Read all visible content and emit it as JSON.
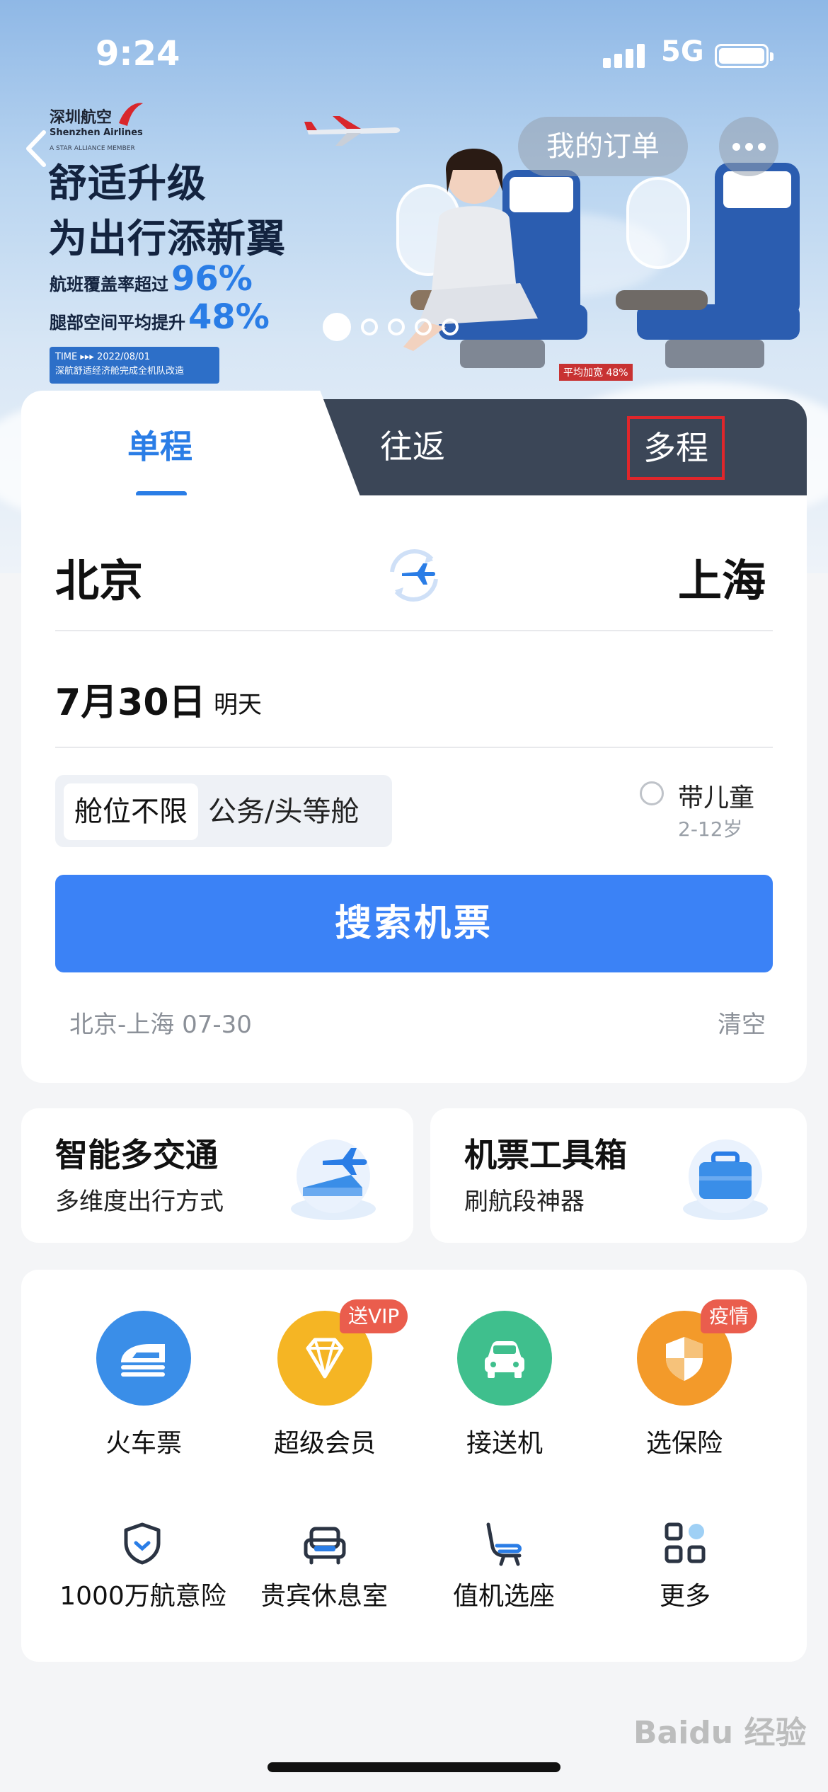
{
  "status_bar": {
    "time": "9:24",
    "network": "5G"
  },
  "header": {
    "orders_label": "我的订单"
  },
  "banner": {
    "airline_cn": "深圳航空",
    "airline_en": "Shenzhen Airlines",
    "alliance": "A STAR ALLIANCE MEMBER",
    "headline_1": "舒适升级",
    "headline_2": "为出行添新翼",
    "stat_1_label": "航班覆盖率超过",
    "stat_1_value": "96%",
    "stat_2_label": "腿部空间平均提升",
    "stat_2_value": "48%",
    "tag_line_1": "TIME ▸▸▸ 2022/08/01",
    "tag_line_2": "深航舒适经济舱完成全机队改造",
    "seat_tag": "平均加宽 48%",
    "page_total": 5,
    "page_current": 1
  },
  "tabs": [
    {
      "label": "单程",
      "active": true
    },
    {
      "label": "往返",
      "active": false
    },
    {
      "label": "多程",
      "active": false,
      "highlighted": true
    }
  ],
  "search": {
    "from_city": "北京",
    "to_city": "上海",
    "date": "7月30日",
    "date_hint": "明天",
    "cabin_options": [
      "舱位不限",
      "公务/头等舱"
    ],
    "cabin_selected": "舱位不限",
    "child_label": "带儿童",
    "child_age": "2-12岁",
    "child_checked": false,
    "button_label": "搜索机票",
    "history": "北京-上海 07-30",
    "clear_label": "清空"
  },
  "promo_cards": [
    {
      "title": "智能多交通",
      "subtitle": "多维度出行方式",
      "icon": "train-plane-icon"
    },
    {
      "title": "机票工具箱",
      "subtitle": "刷航段神器",
      "icon": "suitcase-icon"
    }
  ],
  "services_primary": [
    {
      "label": "火车票",
      "icon": "train-icon",
      "color": "#3a8ee8"
    },
    {
      "label": "超级会员",
      "icon": "diamond-icon",
      "color": "#f5b524",
      "badge": "送VIP"
    },
    {
      "label": "接送机",
      "icon": "car-icon",
      "color": "#3fbf8d"
    },
    {
      "label": "选保险",
      "icon": "shield-icon",
      "color": "#f39a2a",
      "badge": "疫情"
    }
  ],
  "services_secondary": [
    {
      "label": "1000万航意险",
      "icon": "shield-check-icon"
    },
    {
      "label": "贵宾休息室",
      "icon": "sofa-icon"
    },
    {
      "label": "值机选座",
      "icon": "seat-icon"
    },
    {
      "label": "更多",
      "icon": "grid-icon"
    }
  ],
  "watermark": "Baidu 经验",
  "colors": {
    "accent": "#2a7de6",
    "button": "#3b82f6",
    "tab_dark": "#3b4657",
    "badge": "#ea5d4d",
    "highlight_box": "#e0262b"
  }
}
